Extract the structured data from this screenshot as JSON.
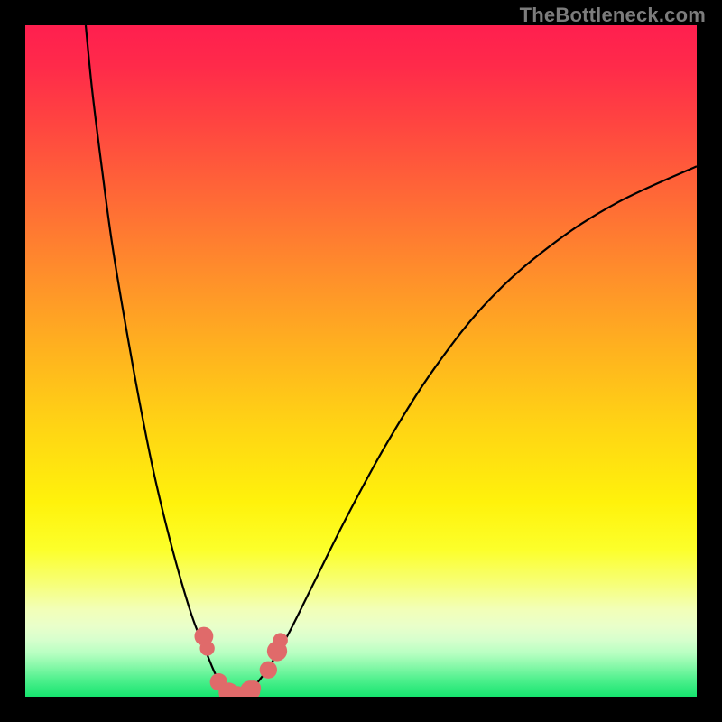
{
  "watermark": "TheBottleneck.com",
  "colors": {
    "frame": "#000000",
    "watermark_text": "#7c7c7c",
    "curve_stroke": "#000000",
    "marker_fill": "#e06a6a",
    "gradient_top": "#ff1f4f",
    "gradient_bottom": "#15e46e"
  },
  "chart_data": {
    "type": "line",
    "title": "",
    "xlabel": "",
    "ylabel": "",
    "xlim": [
      0,
      100
    ],
    "ylim": [
      0,
      100
    ],
    "gradient_stops": [
      {
        "pos": 0,
        "color": "#ff1f4f"
      },
      {
        "pos": 6,
        "color": "#ff2a4a"
      },
      {
        "pos": 15,
        "color": "#ff4640"
      },
      {
        "pos": 26,
        "color": "#ff6a36"
      },
      {
        "pos": 37,
        "color": "#ff8e2b"
      },
      {
        "pos": 48,
        "color": "#ffb11f"
      },
      {
        "pos": 60,
        "color": "#ffd514"
      },
      {
        "pos": 71,
        "color": "#fff20b"
      },
      {
        "pos": 78,
        "color": "#fcff2a"
      },
      {
        "pos": 83,
        "color": "#f7ff75"
      },
      {
        "pos": 87,
        "color": "#f2ffb8"
      },
      {
        "pos": 89.5,
        "color": "#e9ffca"
      },
      {
        "pos": 91.5,
        "color": "#d7ffcd"
      },
      {
        "pos": 93.5,
        "color": "#b8ffc2"
      },
      {
        "pos": 95.5,
        "color": "#85f8a8"
      },
      {
        "pos": 97.5,
        "color": "#4ef08d"
      },
      {
        "pos": 100,
        "color": "#15e46e"
      }
    ],
    "series": [
      {
        "name": "left-curve",
        "points": [
          {
            "x": 9.0,
            "y": 100.0
          },
          {
            "x": 10.0,
            "y": 90.0
          },
          {
            "x": 11.5,
            "y": 78.0
          },
          {
            "x": 13.0,
            "y": 67.0
          },
          {
            "x": 15.0,
            "y": 55.0
          },
          {
            "x": 17.0,
            "y": 44.0
          },
          {
            "x": 19.0,
            "y": 34.0
          },
          {
            "x": 21.0,
            "y": 25.5
          },
          {
            "x": 23.0,
            "y": 18.0
          },
          {
            "x": 25.0,
            "y": 11.5
          },
          {
            "x": 27.0,
            "y": 6.5
          },
          {
            "x": 28.5,
            "y": 3.0
          },
          {
            "x": 30.0,
            "y": 1.0
          },
          {
            "x": 31.5,
            "y": 0.0
          }
        ]
      },
      {
        "name": "right-curve",
        "points": [
          {
            "x": 31.5,
            "y": 0.0
          },
          {
            "x": 33.5,
            "y": 1.0
          },
          {
            "x": 36.0,
            "y": 4.0
          },
          {
            "x": 39.0,
            "y": 9.0
          },
          {
            "x": 43.0,
            "y": 17.0
          },
          {
            "x": 48.0,
            "y": 27.0
          },
          {
            "x": 54.0,
            "y": 38.0
          },
          {
            "x": 61.0,
            "y": 49.0
          },
          {
            "x": 69.0,
            "y": 59.0
          },
          {
            "x": 78.0,
            "y": 67.0
          },
          {
            "x": 88.0,
            "y": 73.5
          },
          {
            "x": 100.0,
            "y": 79.0
          }
        ]
      }
    ],
    "markers": [
      {
        "x": 26.6,
        "y": 9.0,
        "r": 1.4
      },
      {
        "x": 27.1,
        "y": 7.2,
        "r": 1.1
      },
      {
        "x": 28.8,
        "y": 2.2,
        "r": 1.3
      },
      {
        "x": 30.3,
        "y": 0.6,
        "r": 1.5
      },
      {
        "x": 31.5,
        "y": 0.2,
        "r": 1.4
      },
      {
        "x": 33.5,
        "y": 0.9,
        "r": 1.5
      },
      {
        "x": 34.0,
        "y": 1.3,
        "r": 1.1
      },
      {
        "x": 36.2,
        "y": 4.0,
        "r": 1.3
      },
      {
        "x": 37.5,
        "y": 6.8,
        "r": 1.5
      },
      {
        "x": 38.0,
        "y": 8.4,
        "r": 1.1
      }
    ]
  }
}
